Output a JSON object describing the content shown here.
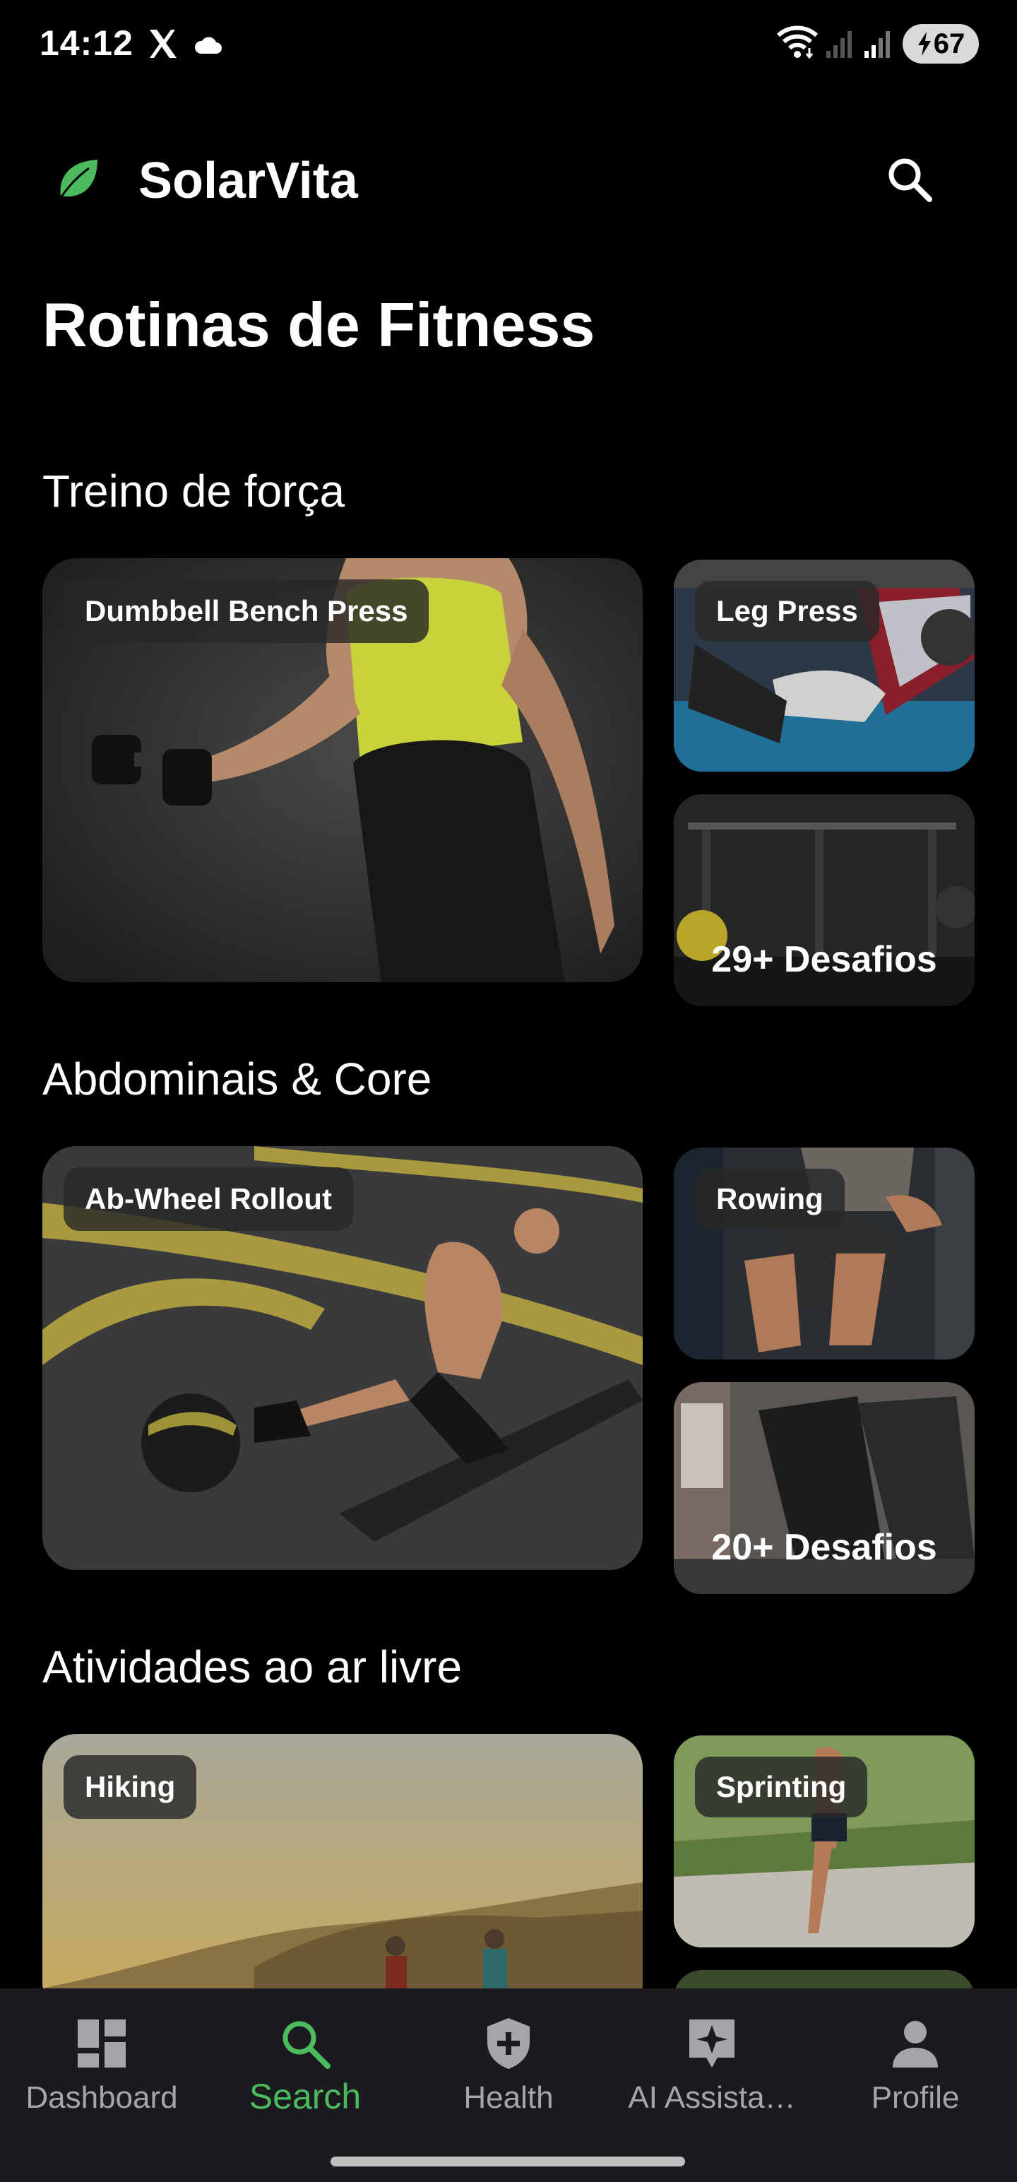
{
  "status_bar": {
    "time": "14:12",
    "battery": "67"
  },
  "app": {
    "title": "SolarVita",
    "accent_color": "#4cbb5e"
  },
  "page": {
    "title": "Rotinas de Fitness"
  },
  "sections": [
    {
      "title": "Treino de força",
      "main_card": {
        "label": "Dumbbell Bench Press"
      },
      "side_cards": [
        {
          "label": "Leg Press"
        },
        {
          "overlay": "29+ Desafios"
        }
      ]
    },
    {
      "title": "Abdominais & Core",
      "main_card": {
        "label": "Ab-Wheel Rollout"
      },
      "side_cards": [
        {
          "label": "Rowing"
        },
        {
          "overlay": "20+ Desafios"
        }
      ]
    },
    {
      "title": "Atividades ao ar livre",
      "main_card": {
        "label": "Hiking"
      },
      "side_cards": [
        {
          "label": "Sprinting"
        }
      ]
    }
  ],
  "bottom_nav": {
    "items": [
      {
        "label": "Dashboard",
        "icon": "dashboard-icon"
      },
      {
        "label": "Search",
        "icon": "search-icon",
        "active": true
      },
      {
        "label": "Health",
        "icon": "health-shield-icon"
      },
      {
        "label": "AI Assista…",
        "icon": "ai-assistant-icon"
      },
      {
        "label": "Profile",
        "icon": "profile-icon"
      }
    ]
  }
}
